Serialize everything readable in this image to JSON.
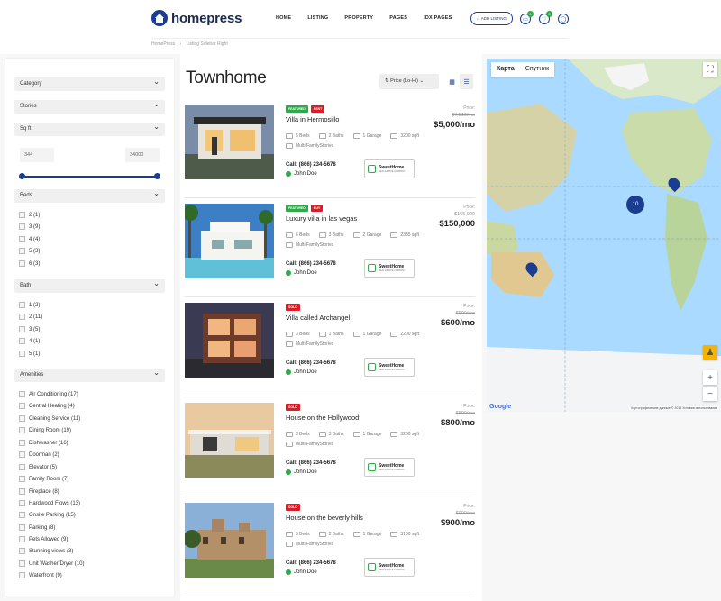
{
  "brand": {
    "name": "homepress"
  },
  "nav": [
    "HOME",
    "LISTING",
    "PROPERTY",
    "PAGES",
    "IDX PAGES"
  ],
  "header": {
    "add_listing": "ADD LISTING",
    "badge_messages": "0",
    "badge_favorites": "0"
  },
  "breadcrumb": {
    "home": "HomePress",
    "sep": "›",
    "current": "Listing Sidebar Right"
  },
  "filters": {
    "category": "Category",
    "stories": "Stories",
    "sqft": "Sq ft",
    "sqft_min": "344",
    "sqft_max": "34000",
    "beds_label": "Beds",
    "beds": [
      "2 (1)",
      "3 (9)",
      "4 (4)",
      "5 (3)",
      "6 (3)"
    ],
    "bath_label": "Bath",
    "bath": [
      "1 (2)",
      "2 (11)",
      "3 (5)",
      "4 (1)",
      "5 (1)"
    ],
    "amenities_label": "Amenities",
    "amenities": [
      "Air Conditioning (17)",
      "Central Heating (4)",
      "Cleaning Service (11)",
      "Dining Room (19)",
      "Dishwasher (16)",
      "Doorman (2)",
      "Elevator (5)",
      "Family Room (7)",
      "Fireplace (8)",
      "Hardwood Flows (13)",
      "Onsite Parking (15)",
      "Parking (8)",
      "Pets Allowed (9)",
      "Stunning views (3)",
      "Unit Washer/Dryer (10)",
      "Waterfront (9)"
    ]
  },
  "page": {
    "title": "Townhome",
    "sort": "Price (Lo-Hi)"
  },
  "listings": [
    {
      "badges": [
        "FEATURED",
        "RENT"
      ],
      "title": "Villa in Hermosillo",
      "beds": "5 Beds",
      "baths": "2 Baths",
      "garage": "1 Garage",
      "sqft": "3200 sqft",
      "type": "Multi FamilyStories",
      "call": "Call: (866) 234-5678",
      "agent": "John Doe",
      "price_label": "Price:",
      "old_price": "$7,500/mo",
      "price": "$5,000/mo"
    },
    {
      "badges": [
        "FEATURED",
        "BUY"
      ],
      "title": "Luxury villa in las vegas",
      "beds": "6 Beds",
      "baths": "3 Baths",
      "garage": "2 Garage",
      "sqft": "2335 sqft",
      "type": "Multi FamilyStories",
      "call": "Call: (866) 234-5678",
      "agent": "John Doe",
      "price_label": "Price:",
      "old_price": "$165,000",
      "price": "$150,000"
    },
    {
      "badges": [
        "SOLD"
      ],
      "title": "Villa called Archangel",
      "beds": "3 Beds",
      "baths": "1 Baths",
      "garage": "1 Garage",
      "sqft": "2200 sqft",
      "type": "Multi FamilyStories",
      "call": "Call: (866) 234-5678",
      "agent": "John Doe",
      "price_label": "Price:",
      "old_price": "$600/mo",
      "price": "$600/mo"
    },
    {
      "badges": [
        "SOLD"
      ],
      "title": "House on the Hollywood",
      "beds": "3 Beds",
      "baths": "3 Baths",
      "garage": "1 Garage",
      "sqft": "3200 sqft",
      "type": "Multi FamilyStories",
      "call": "Call: (866) 234-5678",
      "agent": "John Doe",
      "price_label": "Price:",
      "old_price": "$800/mo",
      "price": "$800/mo"
    },
    {
      "badges": [
        "SOLD"
      ],
      "title": "House on the beverly hills",
      "beds": "3 Beds",
      "baths": "2 Baths",
      "garage": "1 Garage",
      "sqft": "3100 sqft",
      "type": "Multi FamilyStories",
      "call": "Call: (866) 234-5678",
      "agent": "John Doe",
      "price_label": "Price:",
      "old_price": "$900/mo",
      "price": "$900/mo"
    }
  ],
  "sweethome": {
    "name": "SweetHome",
    "sub": "REAL ESTATE COMPANY"
  },
  "map": {
    "tab_map": "Карта",
    "tab_sat": "Спутник",
    "cluster": "10",
    "google": "Google",
    "footer": "Картографические данные © 2019   Условия использования"
  },
  "colors": {
    "accent": "#1a3d8f",
    "badge_green": "#2eaa4a",
    "badge_red": "#d81f26"
  }
}
